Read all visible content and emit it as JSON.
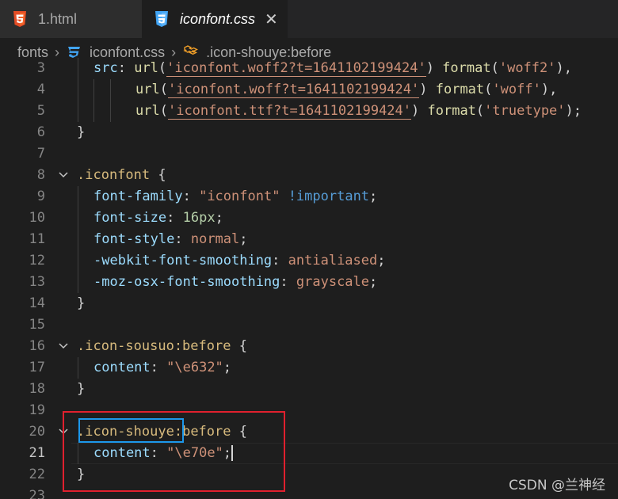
{
  "tabs": [
    {
      "label": "1.html",
      "icon": "html5-icon",
      "active": false
    },
    {
      "label": "iconfont.css",
      "icon": "css3-icon",
      "active": true,
      "close": "✕"
    }
  ],
  "breadcrumb": {
    "folder": "fonts",
    "file": "iconfont.css",
    "symbol": ".icon-shouye:before"
  },
  "colors": {
    "selector": "#d7ba7d",
    "property": "#9cdcfe",
    "string": "#ce9178",
    "number": "#b5cea8",
    "keyword": "#569cd6",
    "function": "#dcdcaa",
    "highlight_red": "#e0202e",
    "highlight_blue": "#1c97ea"
  },
  "editor": {
    "current_line": "21",
    "lines": [
      {
        "n": "3",
        "parts": [
          "src",
          ": ",
          "url",
          "(",
          "'iconfont.woff2?t=1641102199424'",
          ") ",
          "format",
          "(",
          "'woff2'",
          "),"
        ]
      },
      {
        "n": "4",
        "parts": [
          "url",
          "(",
          "'iconfont.woff?t=1641102199424'",
          ") ",
          "format",
          "(",
          "'woff'",
          "),"
        ]
      },
      {
        "n": "5",
        "parts": [
          "url",
          "(",
          "'iconfont.ttf?t=1641102199424'",
          ") ",
          "format",
          "(",
          "'truetype'",
          ");"
        ]
      },
      {
        "n": "6",
        "parts": [
          "}"
        ]
      },
      {
        "n": "7",
        "parts": []
      },
      {
        "n": "8",
        "parts": [
          ".iconfont",
          " {"
        ]
      },
      {
        "n": "9",
        "parts": [
          "font-family",
          ": ",
          "\"iconfont\"",
          " ",
          "!important",
          ";"
        ]
      },
      {
        "n": "10",
        "parts": [
          "font-size",
          ": ",
          "16px",
          ";"
        ]
      },
      {
        "n": "11",
        "parts": [
          "font-style",
          ": ",
          "normal",
          ";"
        ]
      },
      {
        "n": "12",
        "parts": [
          "-webkit-font-smoothing",
          ": ",
          "antialiased",
          ";"
        ]
      },
      {
        "n": "13",
        "parts": [
          "-moz-osx-font-smoothing",
          ": ",
          "grayscale",
          ";"
        ]
      },
      {
        "n": "14",
        "parts": [
          "}"
        ]
      },
      {
        "n": "15",
        "parts": []
      },
      {
        "n": "16",
        "parts": [
          ".icon-sousuo:before",
          " {"
        ]
      },
      {
        "n": "17",
        "parts": [
          "content",
          ": ",
          "\"\\e632\"",
          ";"
        ]
      },
      {
        "n": "18",
        "parts": [
          "}"
        ]
      },
      {
        "n": "19",
        "parts": []
      },
      {
        "n": "20",
        "parts": [
          ".",
          "icon-shouye",
          ":before",
          " {"
        ]
      },
      {
        "n": "21",
        "parts": [
          "content",
          ": ",
          "\"\\e70e\"",
          ";"
        ]
      },
      {
        "n": "22",
        "parts": [
          "}"
        ]
      },
      {
        "n": "23",
        "parts": []
      }
    ]
  },
  "watermark": "CSDN @兰神经"
}
